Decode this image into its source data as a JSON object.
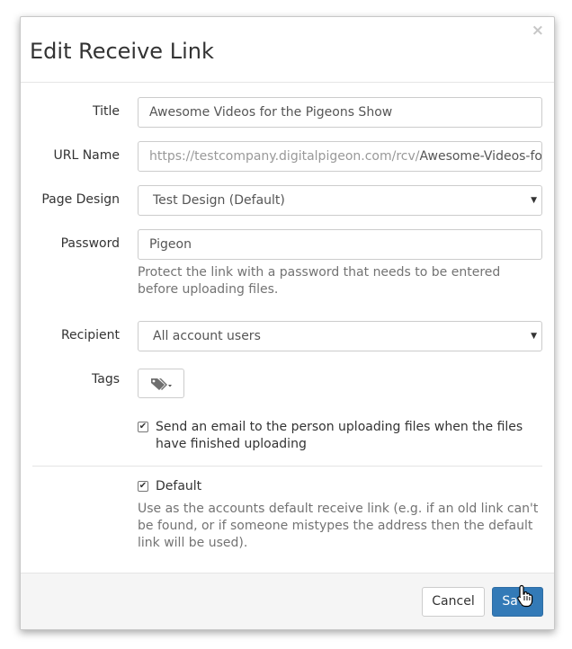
{
  "modal": {
    "title": "Edit Receive Link",
    "close_glyph": "×"
  },
  "form": {
    "title": {
      "label": "Title",
      "value": "Awesome Videos for the Pigeons Show"
    },
    "url_name": {
      "label": "URL Name",
      "prefix": "https://testcompany.digitalpigeon.com/rcv/",
      "value": "Awesome-Videos-for-t"
    },
    "page_design": {
      "label": "Page Design",
      "selected": "Test Design (Default)"
    },
    "password": {
      "label": "Password",
      "value": "Pigeon",
      "help": "Protect the link with a password that needs to be entered before uploading files."
    },
    "recipient": {
      "label": "Recipient",
      "selected": "All account users"
    },
    "tags": {
      "label": "Tags",
      "icon": "tags-icon"
    },
    "email_notify": {
      "checked": true,
      "label": "Send an email to the person uploading files when the files have finished uploading"
    },
    "default": {
      "checked": true,
      "label": "Default",
      "help": "Use as the accounts default receive link (e.g. if an old link can't be found, or if someone mistypes the address then the default link will be used)."
    }
  },
  "footer": {
    "cancel_label": "Cancel",
    "save_label": "Save"
  },
  "colors": {
    "primary": "#337ab7",
    "footer_bg": "#f5f5f5",
    "help_text": "#737373"
  },
  "symbols": {
    "select_arrow": "▼",
    "check": "✔"
  }
}
